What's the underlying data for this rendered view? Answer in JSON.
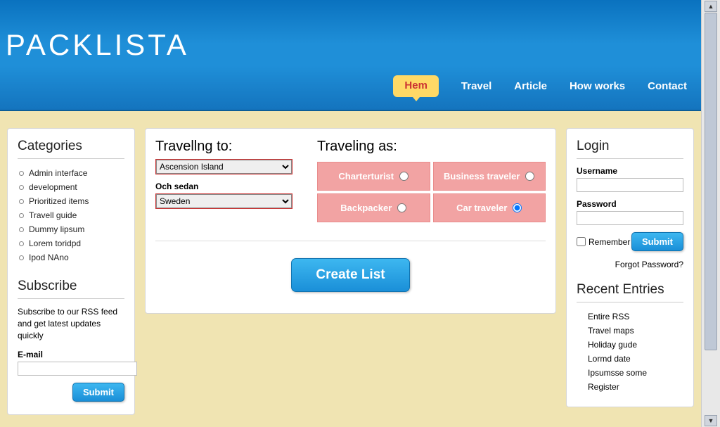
{
  "brand": "Packlista",
  "nav": {
    "items": [
      {
        "label": "Hem",
        "active": true
      },
      {
        "label": "Travel",
        "active": false
      },
      {
        "label": "Article",
        "active": false
      },
      {
        "label": "How works",
        "active": false
      },
      {
        "label": "Contact",
        "active": false
      }
    ]
  },
  "left": {
    "categories_title": "Categories",
    "categories": [
      "Admin interface",
      "development",
      "Prioritized items",
      "Travell guide",
      "Dummy lipsum",
      "Lorem toridpd",
      "Ipod NAno"
    ],
    "subscribe_title": "Subscribe",
    "subscribe_text": "Subscribe to our RSS feed and get latest updates quickly",
    "email_label": "E-mail",
    "submit_label": "Submit"
  },
  "center": {
    "travelling_to_label": "Travellng to:",
    "destination_value": "Ascension Island",
    "och_sedan_label": "Och sedan",
    "och_sedan_value": "Sweden",
    "traveling_as_label": "Traveling as:",
    "travelers": [
      {
        "label": "Charterturist",
        "selected": false
      },
      {
        "label": "Business traveler",
        "selected": false
      },
      {
        "label": "Backpacker",
        "selected": false
      },
      {
        "label": "Car traveler",
        "selected": true
      }
    ],
    "create_list_label": "Create List"
  },
  "right": {
    "login_title": "Login",
    "username_label": "Username",
    "password_label": "Password",
    "remember_label": "Remember",
    "submit_label": "Submit",
    "forgot_label": "Forgot Password?",
    "recent_title": "Recent Entries",
    "entries": [
      "Entire RSS",
      "Travel maps",
      "Holiday gude",
      "Lormd date",
      "Ipsumsse some",
      "Register"
    ]
  }
}
